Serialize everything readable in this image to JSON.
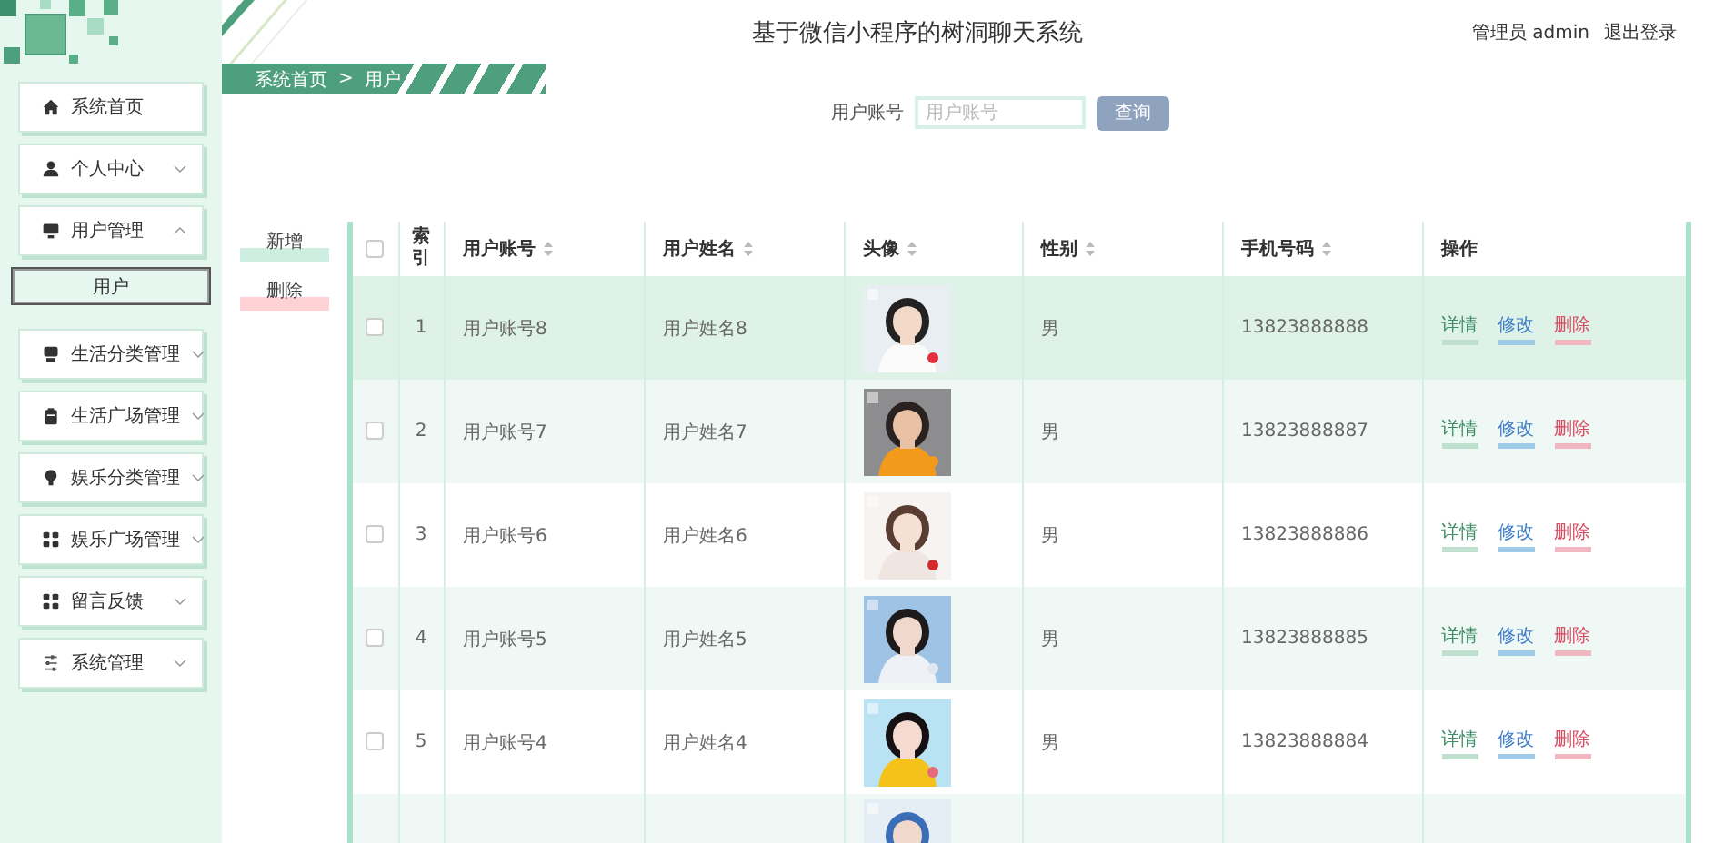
{
  "app": {
    "title": "基于微信小程序的树洞聊天系统",
    "user": "管理员 admin",
    "logout": "退出登录"
  },
  "sidebar": {
    "items": [
      {
        "kind": "link",
        "label": "系统首页"
      },
      {
        "kind": "group",
        "label": "个人中心",
        "expanded": false
      },
      {
        "kind": "group",
        "label": "用户管理",
        "expanded": true,
        "children": [
          {
            "label": "用户",
            "selected": true
          }
        ]
      },
      {
        "kind": "group",
        "label": "生活分类管理",
        "expanded": false
      },
      {
        "kind": "group",
        "label": "生活广场管理",
        "expanded": false
      },
      {
        "kind": "group",
        "label": "娱乐分类管理",
        "expanded": false
      },
      {
        "kind": "group",
        "label": "娱乐广场管理",
        "expanded": false
      },
      {
        "kind": "group",
        "label": "留言反馈",
        "expanded": false
      },
      {
        "kind": "group",
        "label": "系统管理",
        "expanded": false
      }
    ]
  },
  "breadcrumb": {
    "items": [
      "系统首页",
      "用户"
    ],
    "separator": ">"
  },
  "search": {
    "label": "用户账号",
    "placeholder": "用户账号",
    "button": "查询"
  },
  "actions": [
    {
      "kind": "add",
      "label": "新增"
    },
    {
      "kind": "delete",
      "label": "删除"
    }
  ],
  "table": {
    "columns": [
      {
        "kind": "checkbox",
        "checked": false
      },
      {
        "kind": "text",
        "label": "索引"
      },
      {
        "kind": "sortable",
        "label": "用户账号"
      },
      {
        "kind": "sortable",
        "label": "用户姓名"
      },
      {
        "kind": "sortable",
        "label": "头像"
      },
      {
        "kind": "sortable",
        "label": "性别"
      },
      {
        "kind": "sortable",
        "label": "手机号码"
      },
      {
        "kind": "text",
        "label": "操作"
      }
    ],
    "rows": [
      {
        "checked": false,
        "hovered": true,
        "index": "1",
        "account": "用户账号8",
        "name": "用户姓名8",
        "gender": "男",
        "phone": "13823888888",
        "actions": [
          {
            "kind": "detail",
            "label": "详情"
          },
          {
            "kind": "edit",
            "label": "修改"
          },
          {
            "kind": "delete",
            "label": "删除"
          }
        ]
      },
      {
        "checked": false,
        "hovered": false,
        "index": "2",
        "account": "用户账号7",
        "name": "用户姓名7",
        "gender": "男",
        "phone": "13823888887",
        "actions": [
          {
            "kind": "detail",
            "label": "详情"
          },
          {
            "kind": "edit",
            "label": "修改"
          },
          {
            "kind": "delete",
            "label": "删除"
          }
        ]
      },
      {
        "checked": false,
        "hovered": false,
        "index": "3",
        "account": "用户账号6",
        "name": "用户姓名6",
        "gender": "男",
        "phone": "13823888886",
        "actions": [
          {
            "kind": "detail",
            "label": "详情"
          },
          {
            "kind": "edit",
            "label": "修改"
          },
          {
            "kind": "delete",
            "label": "删除"
          }
        ]
      },
      {
        "checked": false,
        "hovered": false,
        "index": "4",
        "account": "用户账号5",
        "name": "用户姓名5",
        "gender": "男",
        "phone": "13823888885",
        "actions": [
          {
            "kind": "detail",
            "label": "详情"
          },
          {
            "kind": "edit",
            "label": "修改"
          },
          {
            "kind": "delete",
            "label": "删除"
          }
        ]
      },
      {
        "checked": false,
        "hovered": false,
        "index": "5",
        "account": "用户账号4",
        "name": "用户姓名4",
        "gender": "男",
        "phone": "13823888884",
        "actions": [
          {
            "kind": "detail",
            "label": "详情"
          },
          {
            "kind": "edit",
            "label": "修改"
          },
          {
            "kind": "delete",
            "label": "删除"
          }
        ]
      },
      {
        "hovered": false
      }
    ]
  }
}
